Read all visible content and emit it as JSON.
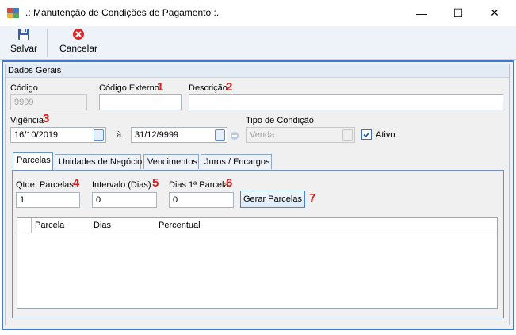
{
  "window": {
    "title": ".: Manutenção de Condições de Pagamento :.",
    "minimize_glyph": "—",
    "maximize_glyph": "☐",
    "close_glyph": "✕"
  },
  "toolbar": {
    "save_label": "Salvar",
    "cancel_label": "Cancelar",
    "save_icon": "floppy-disk-icon",
    "cancel_icon": "red-x-circle-icon"
  },
  "group": {
    "title": "Dados Gerais"
  },
  "fields": {
    "codigo_label": "Código",
    "codigo_value": "9999",
    "codigo_externo_label": "Código Externo",
    "codigo_externo_value": "",
    "descricao_label": "Descrição",
    "descricao_value": "",
    "vigencia_label": "Vigência",
    "vigencia_start": "16/10/2019",
    "vigencia_sep": "à",
    "vigencia_end": "31/12/9999",
    "tipo_condicao_label": "Tipo de Condição",
    "tipo_condicao_value": "Venda",
    "ativo_label": "Ativo",
    "ativo_checked": true
  },
  "markers": [
    "1",
    "2",
    "3",
    "4",
    "5",
    "6",
    "7"
  ],
  "tabs": [
    {
      "label": "Parcelas",
      "active": true
    },
    {
      "label": "Unidades de Negócio",
      "active": false
    },
    {
      "label": "Vencimentos",
      "active": false
    },
    {
      "label": "Juros / Encargos",
      "active": false
    }
  ],
  "parcelas": {
    "qtde_label": "Qtde. Parcelas",
    "qtde_value": "1",
    "intervalo_label": "Intervalo (Dias)",
    "intervalo_value": "0",
    "dias_label": "Dias 1ª Parcela",
    "dias_value": "0",
    "gerar_label": "Gerar Parcelas"
  },
  "grid": {
    "columns": [
      "Parcela",
      "Dias",
      "Percentual"
    ],
    "rows": []
  },
  "colors": {
    "accent": "#3d7cc9",
    "marker_red": "#d42020"
  }
}
